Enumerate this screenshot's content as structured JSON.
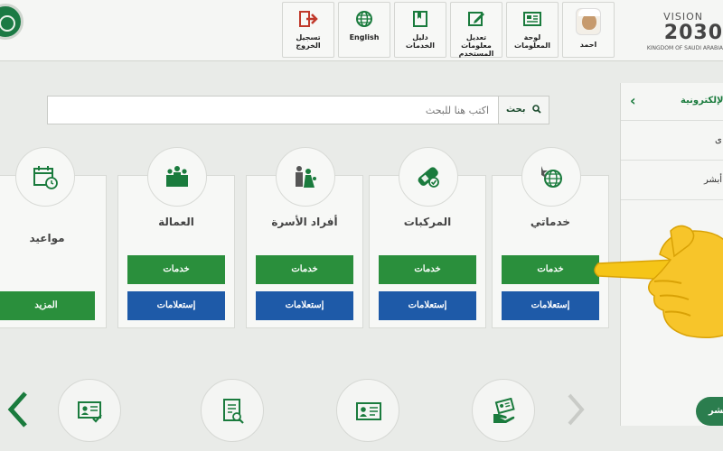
{
  "header": {
    "logout_label": "تسجيل الخروج",
    "english_label": "English",
    "services_guide_label": "دليل الخدمات",
    "edit_user_info_label": "تعديل معلومات المستخدم",
    "dashboard_label": "لوحة المعلومات",
    "user_name": "احمد",
    "vision_word": "VISION",
    "vision_year": "2030",
    "vision_sub": "KINGDOM OF SAUDI ARABIA"
  },
  "search": {
    "placeholder": "اكتب هنا للبحث",
    "button_label": "بحث"
  },
  "side_menu": {
    "title": "الإلكترونية",
    "items": [
      "ى",
      "ت أبشر"
    ]
  },
  "cards": [
    {
      "title": "مواعيد",
      "green_label": "المزيد"
    },
    {
      "title": "العمالة",
      "green_label": "خدمات",
      "blue_label": "إستعلامات"
    },
    {
      "title": "أفراد الأسرة",
      "green_label": "خدمات",
      "blue_label": "إستعلامات"
    },
    {
      "title": "المركبات",
      "green_label": "خدمات",
      "blue_label": "إستعلامات"
    },
    {
      "title": "خدماتي",
      "green_label": "خدمات",
      "blue_label": "إستعلامات"
    }
  ],
  "bottom": {
    "pill_label": "بشر"
  },
  "icons": {
    "cards": [
      "calendar-icon",
      "workers-icon",
      "family-icon",
      "vehicle-icon",
      "globe-icon"
    ],
    "bottom": [
      "id-card-check-icon",
      "document-search-icon",
      "id-card-icon",
      "id-card-hand-icon"
    ]
  },
  "colors": {
    "green_button": "#2a8f3c",
    "blue_button": "#1e5aa8",
    "brand_green": "#1a7b3d",
    "header_icon_red": "#c0392b"
  }
}
